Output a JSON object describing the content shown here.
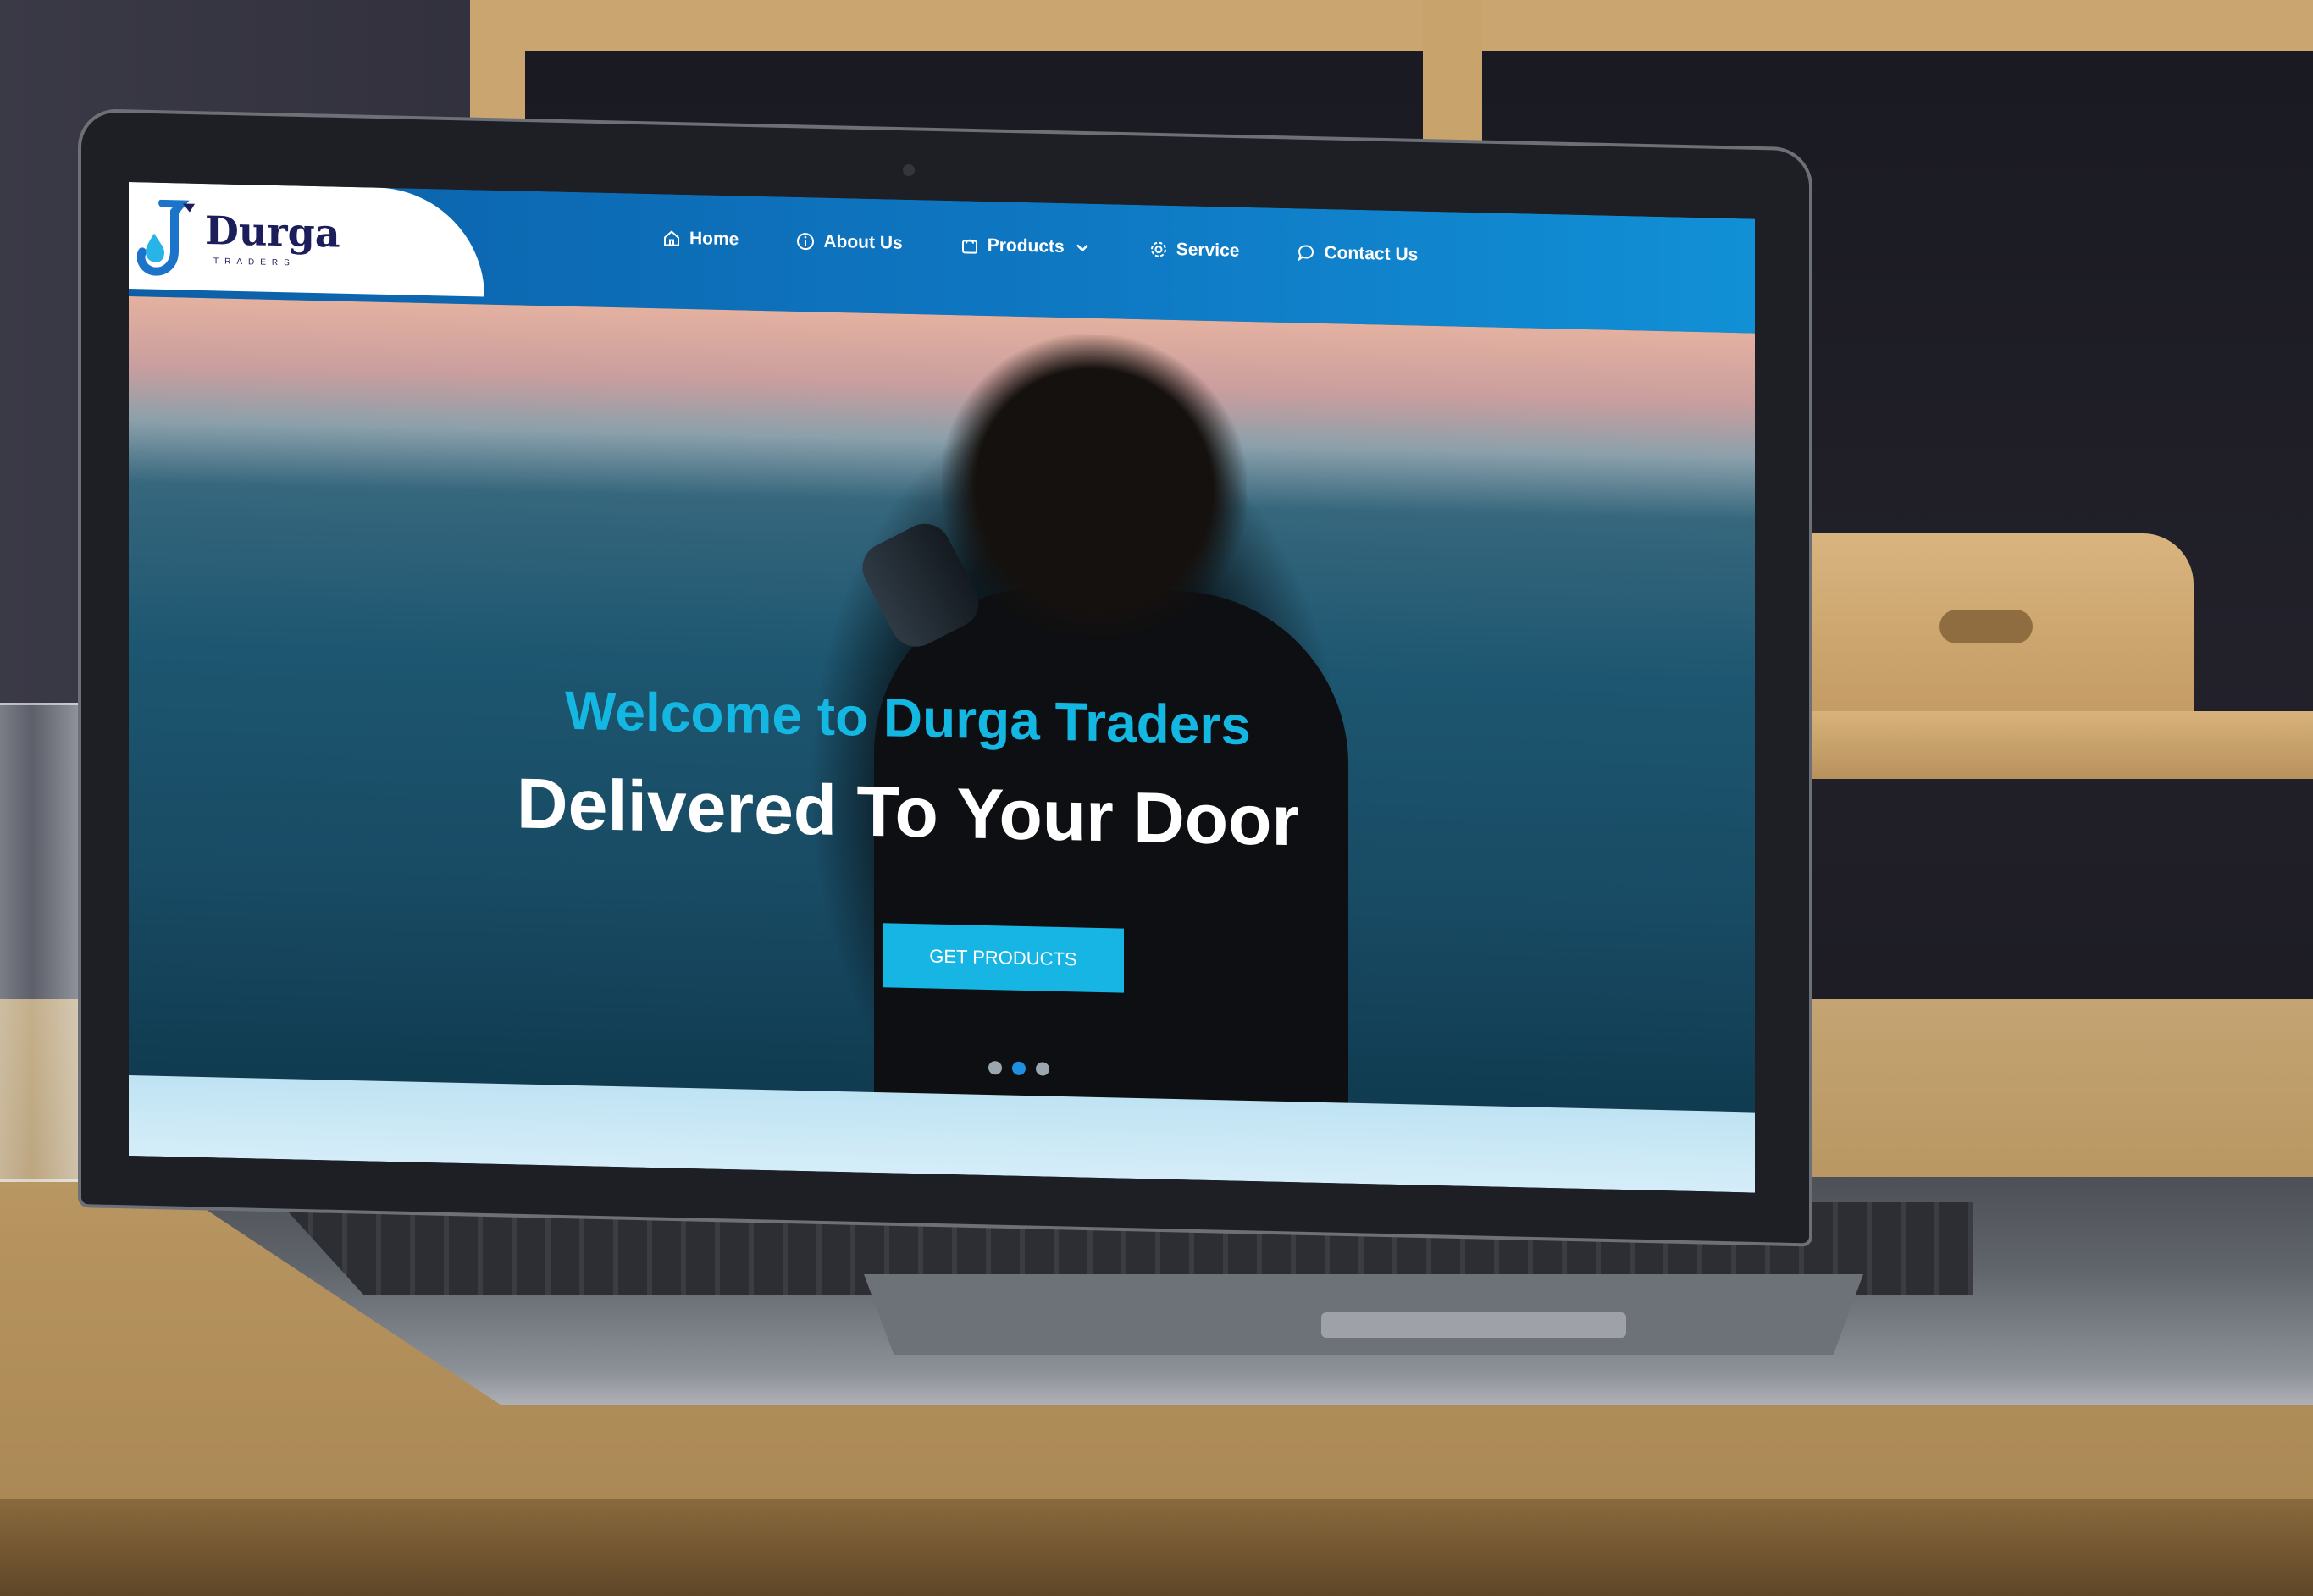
{
  "brand": {
    "name": "Durga",
    "sub": "TRADERS"
  },
  "nav": {
    "items": [
      {
        "label": "Home",
        "icon": "home-icon"
      },
      {
        "label": "About Us",
        "icon": "info-icon"
      },
      {
        "label": "Products",
        "icon": "bag-icon",
        "dropdown": true
      },
      {
        "label": "Service",
        "icon": "gear-icon"
      },
      {
        "label": "Contact Us",
        "icon": "chat-icon"
      }
    ]
  },
  "hero": {
    "eyebrow": "Welcome to Durga Traders",
    "title": "Delivered To Your Door",
    "button_label": "GET PRODUCTS",
    "slides_total": 3,
    "slide_active": 2
  },
  "colors": {
    "navbar": "#0f79c4",
    "accent": "#17b5e4",
    "brand_text": "#1b1e5a"
  }
}
